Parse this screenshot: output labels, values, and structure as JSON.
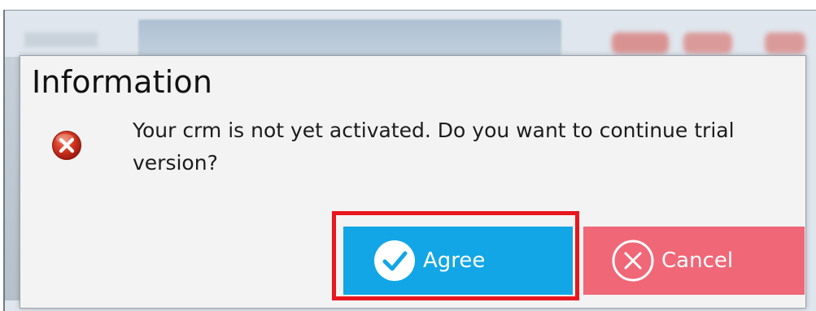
{
  "dialog": {
    "title": "Information",
    "message": "Your crm is not yet activated. Do you want to continue trial version?",
    "icon": "error-icon"
  },
  "buttons": {
    "agree_label": "Agree",
    "agree_icon": "check-circle-icon",
    "cancel_label": "Cancel",
    "cancel_icon": "x-circle-icon"
  },
  "colors": {
    "agree_bg": "#12a6e6",
    "cancel_bg": "#f06777",
    "highlight": "#e8161e",
    "error_red": "#c7281f"
  }
}
